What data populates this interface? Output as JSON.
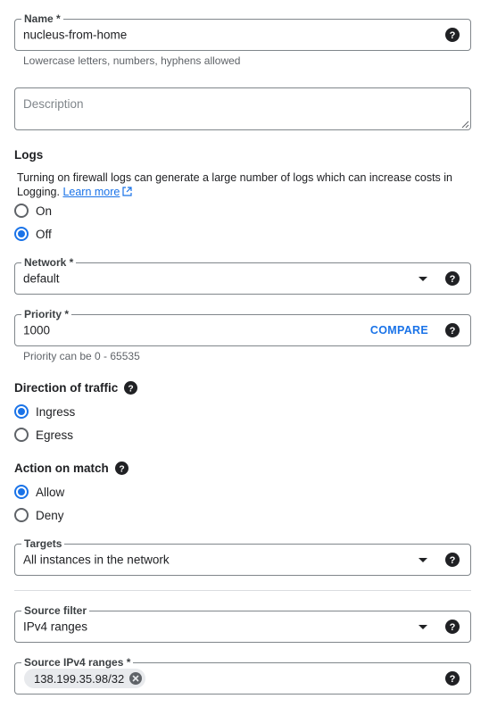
{
  "name_field": {
    "label": "Name *",
    "value": "nucleus-from-home",
    "hint": "Lowercase letters, numbers, hyphens allowed"
  },
  "description_field": {
    "placeholder": "Description"
  },
  "logs": {
    "title": "Logs",
    "text": "Turning on firewall logs can generate a large number of logs which can increase costs in Logging.",
    "link": "Learn more",
    "options": [
      {
        "label": "On",
        "selected": false
      },
      {
        "label": "Off",
        "selected": true
      }
    ]
  },
  "network_field": {
    "label": "Network *",
    "value": "default"
  },
  "priority_field": {
    "label": "Priority *",
    "value": "1000",
    "action": "COMPARE",
    "hint": "Priority can be 0 - 65535"
  },
  "direction": {
    "title": "Direction of traffic",
    "options": [
      {
        "label": "Ingress",
        "selected": true
      },
      {
        "label": "Egress",
        "selected": false
      }
    ]
  },
  "action_on_match": {
    "title": "Action on match",
    "options": [
      {
        "label": "Allow",
        "selected": true
      },
      {
        "label": "Deny",
        "selected": false
      }
    ]
  },
  "targets_field": {
    "label": "Targets",
    "value": "All instances in the network"
  },
  "source_filter_field": {
    "label": "Source filter",
    "value": "IPv4 ranges"
  },
  "source_ranges_field": {
    "label": "Source IPv4 ranges *",
    "chips": [
      "138.199.35.98/32"
    ]
  },
  "icons": {
    "help": "help-circle-icon",
    "dropdown": "caret-down-icon",
    "external_link": "open-in-new-icon",
    "chip_remove": "cancel-circle-icon"
  },
  "colors": {
    "accent": "#1a73e8",
    "border": "#80868b",
    "text": "#202124",
    "hint": "#5f6368",
    "chip_bg": "#e8eaed"
  }
}
